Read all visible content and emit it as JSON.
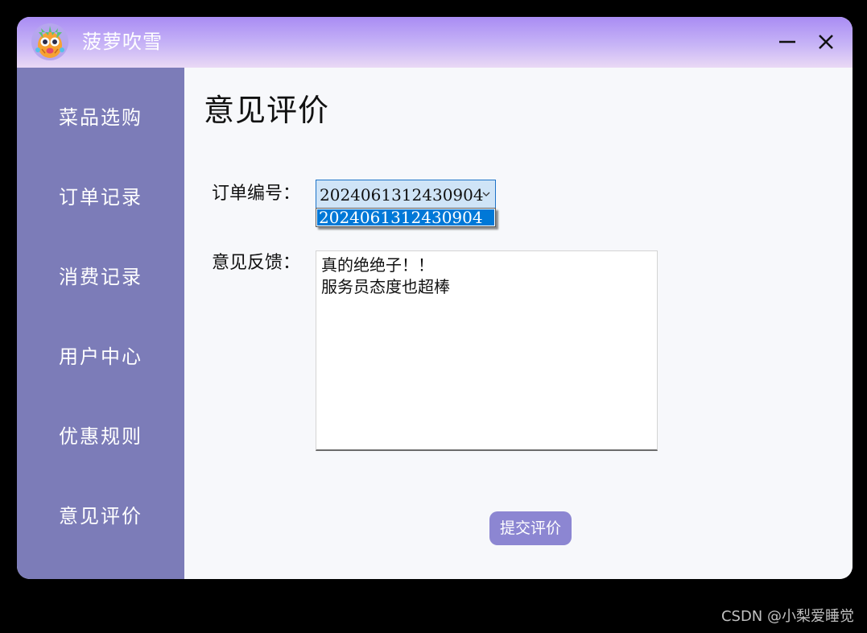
{
  "window": {
    "title": "菠萝吹雪",
    "logo_icon": "pineapple-mascot-icon",
    "controls": {
      "minimize_icon": "minimize-icon",
      "close_icon": "close-icon"
    }
  },
  "sidebar": {
    "items": [
      {
        "label": "菜品选购"
      },
      {
        "label": "订单记录"
      },
      {
        "label": "消费记录"
      },
      {
        "label": "用户中心"
      },
      {
        "label": "优惠规则"
      },
      {
        "label": "意见评价"
      }
    ]
  },
  "main": {
    "title": "意见评价",
    "order": {
      "label": "订单编号：",
      "selected": "2024061312430904",
      "options": [
        "2024061312430904"
      ]
    },
    "feedback": {
      "label": "意见反馈：",
      "lines": [
        "真的绝绝子！！",
        "服务员态度也超棒"
      ]
    },
    "submit_label": "提交评价"
  },
  "watermark": "CSDN @小梨爱睡觉",
  "colors": {
    "sidebar_bg": "#7c7cb8",
    "titlebar_top": "#a98cf4",
    "titlebar_bottom": "#ead9f5",
    "select_highlight": "#0078d7",
    "submit_bg": "#8c86d2",
    "content_bg": "#f7f8fb"
  }
}
